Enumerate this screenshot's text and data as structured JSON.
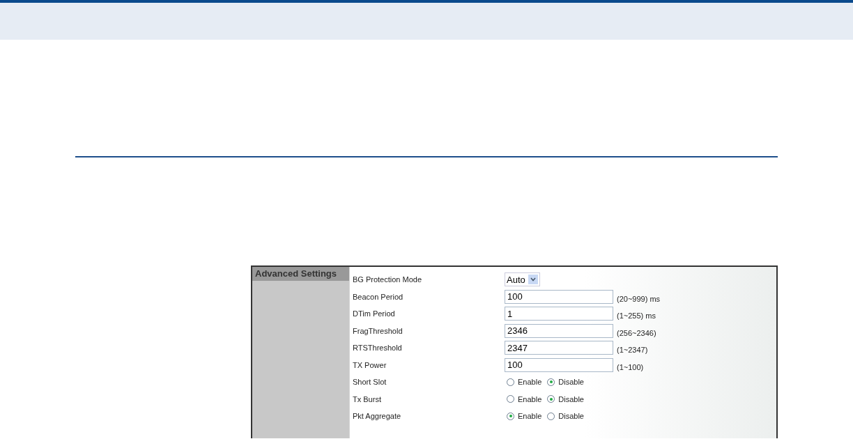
{
  "panel": {
    "title": "Advanced Settings",
    "rows": [
      {
        "kind": "select",
        "label": "BG Protection Mode",
        "value": "Auto"
      },
      {
        "kind": "text",
        "label": "Beacon Period",
        "value": "100",
        "hint": "(20~999) ms"
      },
      {
        "kind": "text",
        "label": "DTim Period",
        "value": "1",
        "hint": "(1~255) ms"
      },
      {
        "kind": "text",
        "label": "FragThreshold",
        "value": "2346",
        "hint": "(256~2346)"
      },
      {
        "kind": "text",
        "label": "RTSThreshold",
        "value": "2347",
        "hint": "(1~2347)"
      },
      {
        "kind": "text",
        "label": "TX Power",
        "value": "100",
        "hint": "(1~100)"
      },
      {
        "kind": "radio",
        "label": "Short Slot",
        "options": [
          {
            "label": "Enable",
            "selected": false
          },
          {
            "label": "Disable",
            "selected": true
          }
        ]
      },
      {
        "kind": "radio",
        "label": "Tx Burst",
        "options": [
          {
            "label": "Enable",
            "selected": false
          },
          {
            "label": "Disable",
            "selected": true
          }
        ]
      },
      {
        "kind": "radio",
        "label": "Pkt Aggregate",
        "options": [
          {
            "label": "Enable",
            "selected": true
          },
          {
            "label": "Disable",
            "selected": false
          }
        ]
      }
    ]
  }
}
